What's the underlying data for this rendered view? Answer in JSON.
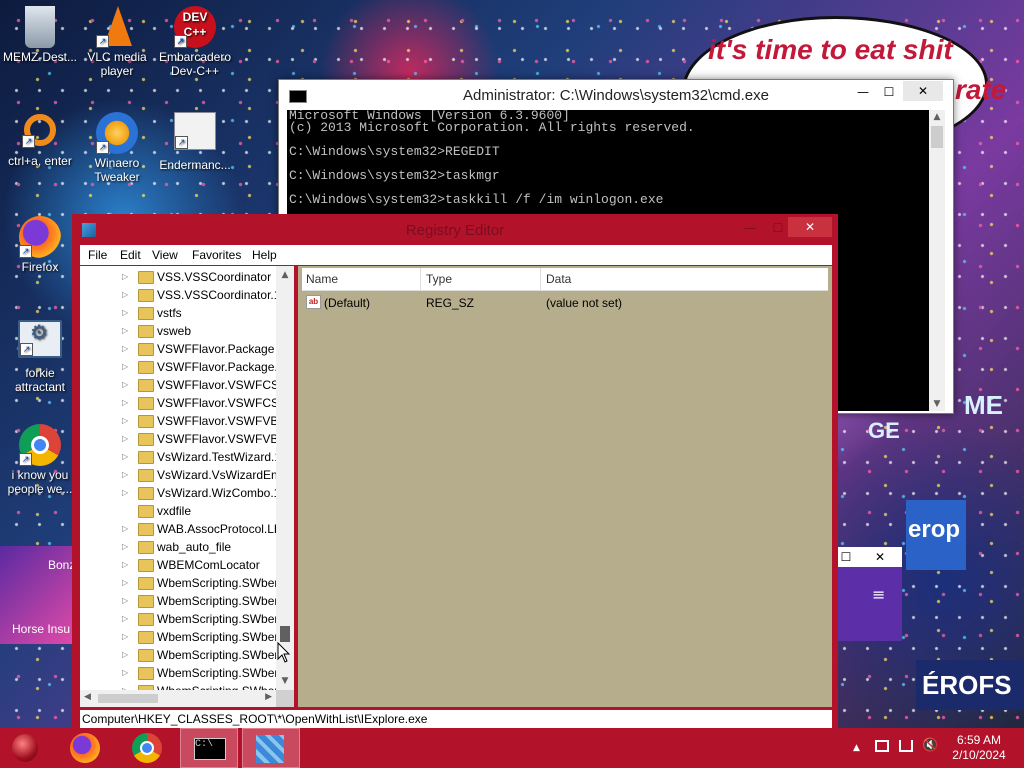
{
  "desktop": {
    "icons": [
      {
        "id": "recycle-bin",
        "label": "MEMZ-Dest..."
      },
      {
        "id": "vlc",
        "label": "VLC media player"
      },
      {
        "id": "devcpp",
        "label": "Embarcadero Dev-C++"
      },
      {
        "id": "ctrl",
        "label": "ctrl+a, enter"
      },
      {
        "id": "winaero",
        "label": "Winaero Tweaker"
      },
      {
        "id": "enderman",
        "label": "Endermanc..."
      },
      {
        "id": "firefox",
        "label": "Firefox"
      },
      {
        "id": "forkie",
        "label": "forkie attractant"
      },
      {
        "id": "chrome",
        "label": "i know you people we..."
      },
      {
        "id": "bonzi",
        "label": "Bonz"
      },
      {
        "id": "horse",
        "label": "Horse Insu"
      }
    ],
    "devcpp_badge": "DEV C++",
    "speech_bubble": "it's time to eat shit",
    "speech_bubble_tail": "rate",
    "background_signs": [
      "GE",
      "ME",
      "erop",
      "ÉROFS"
    ]
  },
  "cmd": {
    "title": "Administrator: C:\\Windows\\system32\\cmd.exe",
    "lines": [
      "Microsoft Windows [Version 6.3.9600]",
      "(c) 2013 Microsoft Corporation. All rights reserved.",
      "",
      "C:\\Windows\\system32>REGEDIT",
      "",
      "C:\\Windows\\system32>taskmgr",
      "",
      "C:\\Windows\\system32>taskkill /f /im winlogon.exe"
    ],
    "minimize": "—",
    "maximize": "☐",
    "close": "✕"
  },
  "regedit": {
    "title": "Registry Editor",
    "menu": [
      "File",
      "Edit",
      "View",
      "Favorites",
      "Help"
    ],
    "tree_items": [
      "VSS.VSSCoordinator",
      "VSS.VSSCoordinator.1",
      "vstfs",
      "vsweb",
      "VSWFFlavor.Package",
      "VSWFFlavor.Package.1",
      "VSWFFlavor.VSWFCSFl",
      "VSWFFlavor.VSWFCSFl",
      "VSWFFlavor.VSWFVBFl",
      "VSWFFlavor.VSWFVBFl",
      "VsWizard.TestWizard.1",
      "VsWizard.VsWizardEng",
      "VsWizard.WizCombo.1",
      "vxdfile",
      "WAB.AssocProtocol.LD",
      "wab_auto_file",
      "WBEMComLocator",
      "WbemScripting.SWber",
      "WbemScripting.SWber",
      "WbemScripting.SWber",
      "WbemScripting.SWber",
      "WbemScripting.SWber",
      "WbemScripting.SWber",
      "WbemScripting.SWber"
    ],
    "columns": {
      "name": "Name",
      "type": "Type",
      "data": "Data"
    },
    "rows": [
      {
        "name": "(Default)",
        "type": "REG_SZ",
        "data": "(value not set)"
      }
    ],
    "status_path": "Computer\\HKEY_CLASSES_ROOT\\*\\OpenWithList\\IExplore.exe",
    "minimize": "—",
    "maximize": "☐",
    "close": "✕"
  },
  "mini_window": {
    "maximize": "☐",
    "close": "✕"
  },
  "taskbar": {
    "buttons": [
      "start",
      "firefox",
      "chrome",
      "cmd",
      "regedit"
    ],
    "tray_up": "▲",
    "time": "6:59 AM",
    "date": "2/10/2024"
  },
  "colors": {
    "accent": "#b3122b",
    "values_pane": "#b6ad8d",
    "bubble_text": "#c2183a"
  }
}
